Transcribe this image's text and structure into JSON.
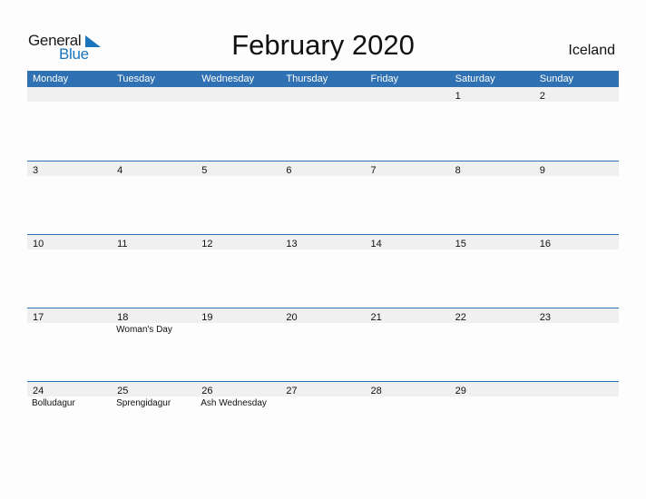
{
  "logo": {
    "general": "General",
    "blue": "Blue"
  },
  "title": "February 2020",
  "country": "Iceland",
  "weekdays": [
    "Monday",
    "Tuesday",
    "Wednesday",
    "Thursday",
    "Friday",
    "Saturday",
    "Sunday"
  ],
  "weeks": [
    {
      "days": [
        "",
        "",
        "",
        "",
        "",
        "1",
        "2"
      ],
      "holidays": [
        "",
        "",
        "",
        "",
        "",
        "",
        ""
      ]
    },
    {
      "days": [
        "3",
        "4",
        "5",
        "6",
        "7",
        "8",
        "9"
      ],
      "holidays": [
        "",
        "",
        "",
        "",
        "",
        "",
        ""
      ]
    },
    {
      "days": [
        "10",
        "11",
        "12",
        "13",
        "14",
        "15",
        "16"
      ],
      "holidays": [
        "",
        "",
        "",
        "",
        "",
        "",
        ""
      ]
    },
    {
      "days": [
        "17",
        "18",
        "19",
        "20",
        "21",
        "22",
        "23"
      ],
      "holidays": [
        "",
        "Woman's Day",
        "",
        "",
        "",
        "",
        ""
      ]
    },
    {
      "days": [
        "24",
        "25",
        "26",
        "27",
        "28",
        "29",
        ""
      ],
      "holidays": [
        "Bolludagur",
        "Sprengidagur",
        "Ash Wednesday",
        "",
        "",
        "",
        ""
      ]
    }
  ],
  "colors": {
    "header": "#2f71b3",
    "band": "#f0f0f0",
    "brand": "#1b75bc"
  }
}
